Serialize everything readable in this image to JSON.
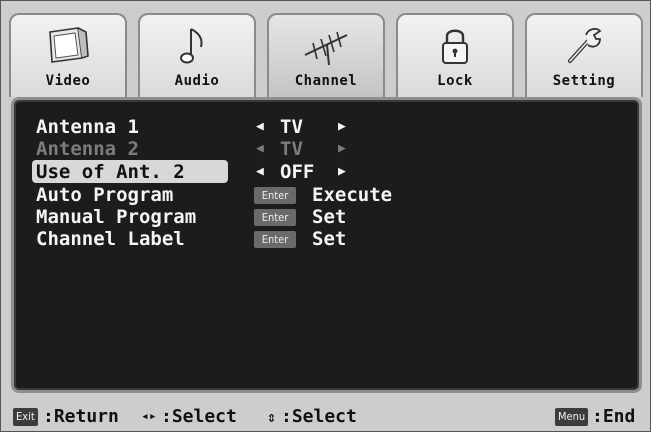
{
  "tabs": [
    {
      "label": "Video",
      "icon": "tv-screen-icon"
    },
    {
      "label": "Audio",
      "icon": "music-note-icon"
    },
    {
      "label": "Channel",
      "icon": "antenna-icon",
      "active": true
    },
    {
      "label": "Lock",
      "icon": "padlock-icon"
    },
    {
      "label": "Setting",
      "icon": "wrench-icon"
    }
  ],
  "menu": {
    "antenna1": {
      "label": "Antenna 1",
      "value": "TV"
    },
    "antenna2": {
      "label": "Antenna 2",
      "value": "TV"
    },
    "use_ant2": {
      "label": "Use of Ant. 2",
      "value": "OFF"
    },
    "auto_program": {
      "label": "Auto Program",
      "key": "Enter",
      "action": "Execute"
    },
    "manual_program": {
      "label": "Manual Program",
      "key": "Enter",
      "action": "Set"
    },
    "channel_label": {
      "label": "Channel Label",
      "key": "Enter",
      "action": "Set"
    }
  },
  "bottom": {
    "exit_key": "Exit",
    "return_text": ":Return",
    "lr_text": ":Select",
    "ud_text": ":Select",
    "menu_key": "Menu",
    "end_text": ":End"
  },
  "colors": {
    "panel_bg": "#1c1c1c",
    "frame_bg": "#cdcdcd",
    "highlight": "#d8d8d8",
    "dim_text": "#7c7c7c"
  }
}
